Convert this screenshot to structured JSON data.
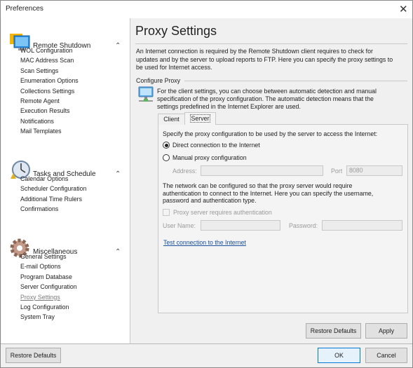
{
  "window": {
    "title": "Preferences",
    "close_icon": "close-icon"
  },
  "sidebar": {
    "groups": [
      {
        "title": "Remote Shutdown",
        "icon": "monitor-icon",
        "items": [
          "WOL Configuration",
          "MAC Address Scan",
          "Scan Settings",
          "Enumeration Options",
          "Collections Settings",
          "Remote Agent",
          "Execution Results",
          "Notifications",
          "Mail Templates"
        ]
      },
      {
        "title": "Tasks and Schedule",
        "icon": "clock-icon",
        "items": [
          "Calendar Options",
          "Scheduler Configuration",
          "Additional Time Rulers",
          "Confirmations"
        ]
      },
      {
        "title": "Miscellaneous",
        "icon": "gear-icon",
        "items": [
          "General Settings",
          "E-mail Options",
          "Program Database",
          "Server Configuration",
          "Proxy Settings",
          "Log Configuration",
          "System Tray"
        ]
      }
    ],
    "active_item": "Proxy Settings",
    "restore_defaults": "Restore Defaults"
  },
  "main": {
    "title": "Proxy Settings",
    "description": [
      "An Internet connection is required by the Remote Shutdown client requires to check for",
      "updates and by the server to upload reports to FTP. Here you can specify the proxy settings to",
      "be used for Internet access."
    ],
    "section": "Configure Proxy",
    "section_text": [
      "For the client settings, you can choose between automatic detection and manual",
      "specification of the proxy configuration. The automatic detection means that the",
      "settings predefined in the Internet Explorer are used."
    ],
    "tabs": [
      {
        "label": "Client",
        "active": false
      },
      {
        "label": "Server",
        "active": true
      }
    ],
    "server": {
      "prompt": "Specify the proxy configuration to be used by the server to access the Internet:",
      "radio_direct": "Direct connection to the Internet",
      "radio_manual": "Manual proxy configuration",
      "selected": "direct",
      "address_label": "Address:",
      "address_value": "",
      "port_label": "Port",
      "port_value": "8080",
      "auth_text": [
        "The network can be configured so that the proxy server would require",
        "authentication to connect to the Internet. Here you can specify the username,",
        "password and authentication type."
      ],
      "auth_checkbox": "Proxy server requires authentication",
      "auth_checked": false,
      "username_label": "User Name:",
      "username_value": "",
      "password_label": "Password:",
      "password_value": "",
      "test_link": "Test connection to the Internet"
    },
    "restore_defaults": "Restore Defaults",
    "apply": "Apply"
  },
  "footer": {
    "ok": "OK",
    "cancel": "Cancel"
  },
  "colors": {
    "link": "#1a4fa0",
    "accent": "#0078d7"
  }
}
